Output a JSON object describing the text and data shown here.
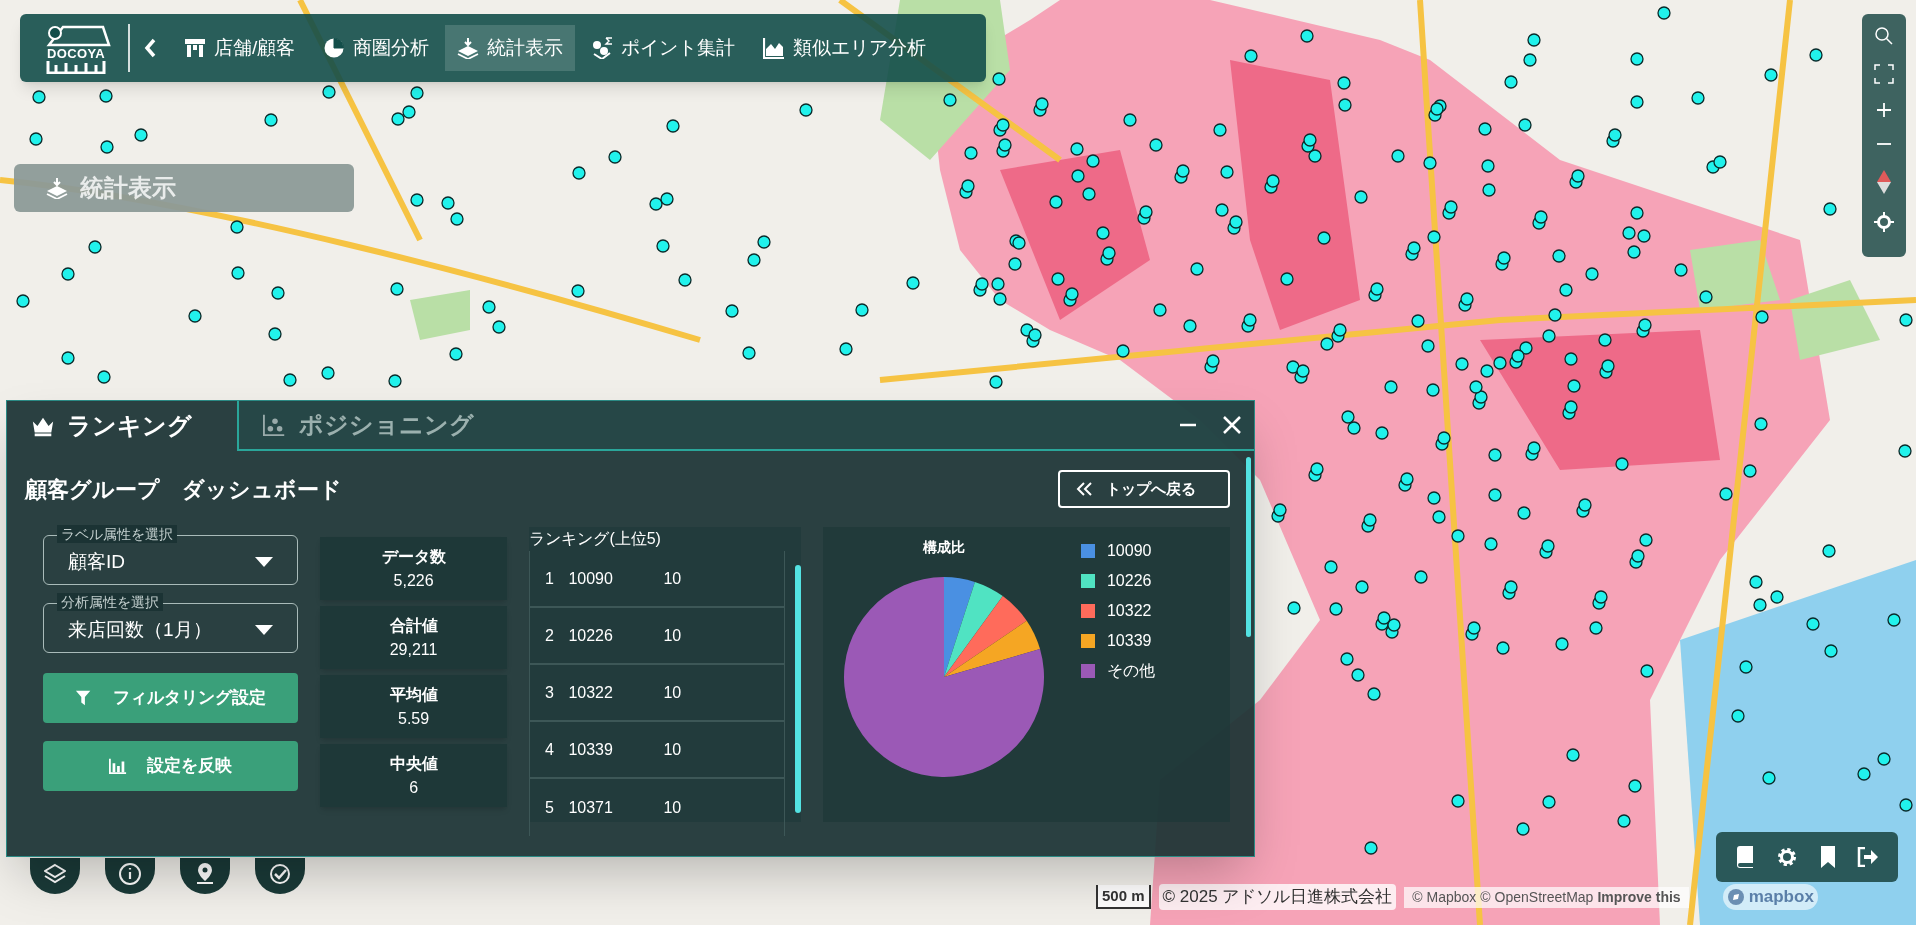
{
  "nav": {
    "logo": "DOCOYA",
    "items": [
      {
        "label": "店舗/顧客",
        "kind": "store",
        "selected": false
      },
      {
        "label": "商圏分析",
        "kind": "pie",
        "selected": false
      },
      {
        "label": "統計表示",
        "kind": "layers",
        "selected": true
      },
      {
        "label": "ポイント集計",
        "kind": "points",
        "selected": false
      },
      {
        "label": "類似エリア分析",
        "kind": "area",
        "selected": false
      }
    ]
  },
  "map_overlay_label": "統計表示",
  "panel": {
    "tabs": [
      {
        "label": "ランキング",
        "kind": "crown",
        "selected": true
      },
      {
        "label": "ポジショニング",
        "kind": "scatter",
        "selected": false
      }
    ],
    "title": "顧客グループ　ダッシュボード",
    "back_button": "トップへ戻る",
    "selects": [
      {
        "label": "ラベル属性を選択",
        "value": "顧客ID"
      },
      {
        "label": "分析属性を選択",
        "value": "来店回数（1月）"
      }
    ],
    "buttons": [
      {
        "label": "フィルタリング設定",
        "kind": "filter"
      },
      {
        "label": "設定を反映",
        "kind": "chart"
      }
    ],
    "stats": [
      {
        "label": "データ数",
        "value": "5,226"
      },
      {
        "label": "合計値",
        "value": "29,211"
      },
      {
        "label": "平均値",
        "value": "5.59"
      },
      {
        "label": "中央値",
        "value": "6"
      }
    ],
    "ranking": {
      "title": "ランキング(上位5)",
      "rows": [
        {
          "rank": "1",
          "id": "10090",
          "value": "10"
        },
        {
          "rank": "2",
          "id": "10226",
          "value": "10"
        },
        {
          "rank": "3",
          "id": "10322",
          "value": "10"
        },
        {
          "rank": "4",
          "id": "10339",
          "value": "10"
        },
        {
          "rank": "5",
          "id": "10371",
          "value": "10"
        }
      ]
    },
    "chart_data": {
      "type": "pie",
      "title": "構成比",
      "categories": [
        "10090",
        "10226",
        "10322",
        "10339",
        "その他"
      ],
      "values": [
        5,
        5,
        5.5,
        5,
        79.5
      ],
      "colors": [
        "#4a90e2",
        "#50e3c2",
        "#ff6b5b",
        "#f5a623",
        "#9b59b6"
      ],
      "legend": "right"
    }
  },
  "attribution": {
    "scale": "500 m",
    "copyright": "© 2025 アドソル日進株式会社",
    "mapbox": "© Mapbox",
    "osm": "© OpenStreetMap",
    "improve": "Improve this",
    "logo": "mapbox"
  }
}
